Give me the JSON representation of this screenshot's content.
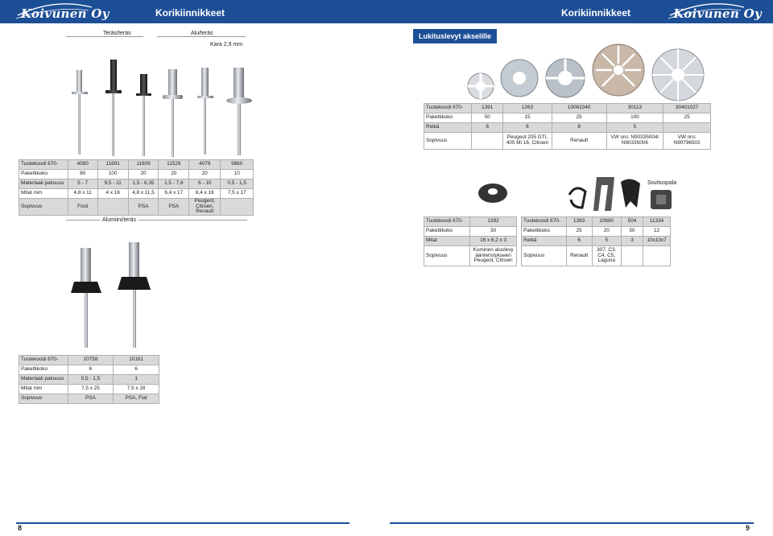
{
  "header": {
    "brand_left": "Koivunen Oy",
    "brand_right": "Koivunen Oy",
    "title_left": "Korikiinnikkeet",
    "title_right": "Korikiinnikkeet"
  },
  "left": {
    "cat_steel_steel": "Teräs/teräs",
    "cat_alu_steel": "Alu/teräs",
    "cat_alu_steel_note": "Kara 2,9 mm",
    "table1": {
      "rows": [
        [
          "Tuotekoodi 670-",
          "4080",
          "11691",
          "11609",
          "11529",
          "4079",
          "9860"
        ],
        [
          "Pakettikoko",
          "80",
          "100",
          "20",
          "20",
          "20",
          "10"
        ],
        [
          "Materiaali paksuus",
          "5 - 7",
          "9,5 - 11",
          "1,5 - 6,35",
          "1,5 - 7,6",
          "6 - 10",
          "0,5 - 1,5"
        ],
        [
          "Mitat mm",
          "4,8 x 11",
          "4 x 16",
          "4,8 x 11,5",
          "6,4 x 17",
          "6,4 x 16",
          "7,5 x 17"
        ],
        [
          "Sopivuus",
          "Ford",
          "",
          "PSA",
          "PSA",
          "Peugeot, Citroen, Renault",
          ""
        ]
      ]
    },
    "cat_aluminium_steel": "Alumiini/teräs",
    "table2": {
      "rows": [
        [
          "Tuotekoodi 670-",
          "10758",
          "10161"
        ],
        [
          "Pakettikoko",
          "6",
          "6"
        ],
        [
          "Materiaali paksuus",
          "0,5 - 1,5",
          "1"
        ],
        [
          "Mitat mm",
          "7,5 x 25",
          "7,5 x 28"
        ],
        [
          "Sopivuus",
          "PSA",
          "PSA, Fiat"
        ]
      ]
    },
    "page_number": "8"
  },
  "right": {
    "section_button": "Lukituslevyt akselille",
    "table3": {
      "rows": [
        [
          "Tuotekoodi 670-",
          "1391",
          "1263",
          "10061040",
          "30113",
          "30401027"
        ],
        [
          "Pakettikoko",
          "50",
          "15",
          "25",
          "100",
          "25"
        ],
        [
          "Reikä",
          "6",
          "6",
          "8",
          "5",
          ""
        ],
        [
          "Sopivuus",
          "",
          "Peugeot 205 GTI, 405 Mi 16, Citroen",
          "Renault",
          "VW nro: N90335004/ N90335006",
          "VW nro: N90796502"
        ]
      ]
    },
    "sovituspala_label": "Sovituspala",
    "table4": {
      "rows": [
        [
          "Tuotekoodi 670-",
          "1392"
        ],
        [
          "Pakettikoko",
          "30"
        ],
        [
          "Mitat",
          "16 x 6,2 x 3"
        ],
        [
          "Sopivuus",
          "Kuminen aluslevy äänieristykseen Peugeot, Citroen"
        ]
      ]
    },
    "table5": {
      "rows": [
        [
          "Tuotekoodi 670-",
          "1393",
          "10680",
          "504",
          "11334"
        ],
        [
          "Pakettikoko",
          "25",
          "20",
          "50",
          "12"
        ],
        [
          "Reikä",
          "6",
          "5",
          "3",
          "10x10x7"
        ],
        [
          "Sopivuus",
          "Renault",
          "307, C3, C4, C5, Laguna",
          "",
          ""
        ]
      ]
    },
    "page_number": "9"
  },
  "colors": {
    "brand_blue": "#1d4f96",
    "row_gray": "#d9d9d9",
    "border_gray": "#b0b0b0"
  },
  "icons": [
    "koivunen-logo-icon",
    "blind-rivet-icon",
    "lock-washer-icon",
    "rubber-washer-icon",
    "spring-clip-icon",
    "fitting-block-icon"
  ]
}
